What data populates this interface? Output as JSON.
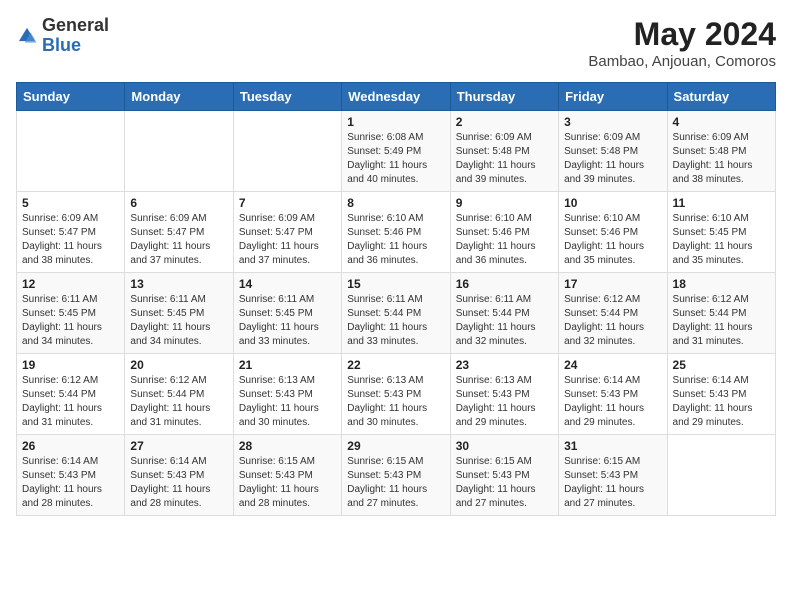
{
  "header": {
    "logo_general": "General",
    "logo_blue": "Blue",
    "title": "May 2024",
    "location": "Bambao, Anjouan, Comoros"
  },
  "days_of_week": [
    "Sunday",
    "Monday",
    "Tuesday",
    "Wednesday",
    "Thursday",
    "Friday",
    "Saturday"
  ],
  "weeks": [
    [
      {
        "day": "",
        "info": ""
      },
      {
        "day": "",
        "info": ""
      },
      {
        "day": "",
        "info": ""
      },
      {
        "day": "1",
        "info": "Sunrise: 6:08 AM\nSunset: 5:49 PM\nDaylight: 11 hours and 40 minutes."
      },
      {
        "day": "2",
        "info": "Sunrise: 6:09 AM\nSunset: 5:48 PM\nDaylight: 11 hours and 39 minutes."
      },
      {
        "day": "3",
        "info": "Sunrise: 6:09 AM\nSunset: 5:48 PM\nDaylight: 11 hours and 39 minutes."
      },
      {
        "day": "4",
        "info": "Sunrise: 6:09 AM\nSunset: 5:48 PM\nDaylight: 11 hours and 38 minutes."
      }
    ],
    [
      {
        "day": "5",
        "info": "Sunrise: 6:09 AM\nSunset: 5:47 PM\nDaylight: 11 hours and 38 minutes."
      },
      {
        "day": "6",
        "info": "Sunrise: 6:09 AM\nSunset: 5:47 PM\nDaylight: 11 hours and 37 minutes."
      },
      {
        "day": "7",
        "info": "Sunrise: 6:09 AM\nSunset: 5:47 PM\nDaylight: 11 hours and 37 minutes."
      },
      {
        "day": "8",
        "info": "Sunrise: 6:10 AM\nSunset: 5:46 PM\nDaylight: 11 hours and 36 minutes."
      },
      {
        "day": "9",
        "info": "Sunrise: 6:10 AM\nSunset: 5:46 PM\nDaylight: 11 hours and 36 minutes."
      },
      {
        "day": "10",
        "info": "Sunrise: 6:10 AM\nSunset: 5:46 PM\nDaylight: 11 hours and 35 minutes."
      },
      {
        "day": "11",
        "info": "Sunrise: 6:10 AM\nSunset: 5:45 PM\nDaylight: 11 hours and 35 minutes."
      }
    ],
    [
      {
        "day": "12",
        "info": "Sunrise: 6:11 AM\nSunset: 5:45 PM\nDaylight: 11 hours and 34 minutes."
      },
      {
        "day": "13",
        "info": "Sunrise: 6:11 AM\nSunset: 5:45 PM\nDaylight: 11 hours and 34 minutes."
      },
      {
        "day": "14",
        "info": "Sunrise: 6:11 AM\nSunset: 5:45 PM\nDaylight: 11 hours and 33 minutes."
      },
      {
        "day": "15",
        "info": "Sunrise: 6:11 AM\nSunset: 5:44 PM\nDaylight: 11 hours and 33 minutes."
      },
      {
        "day": "16",
        "info": "Sunrise: 6:11 AM\nSunset: 5:44 PM\nDaylight: 11 hours and 32 minutes."
      },
      {
        "day": "17",
        "info": "Sunrise: 6:12 AM\nSunset: 5:44 PM\nDaylight: 11 hours and 32 minutes."
      },
      {
        "day": "18",
        "info": "Sunrise: 6:12 AM\nSunset: 5:44 PM\nDaylight: 11 hours and 31 minutes."
      }
    ],
    [
      {
        "day": "19",
        "info": "Sunrise: 6:12 AM\nSunset: 5:44 PM\nDaylight: 11 hours and 31 minutes."
      },
      {
        "day": "20",
        "info": "Sunrise: 6:12 AM\nSunset: 5:44 PM\nDaylight: 11 hours and 31 minutes."
      },
      {
        "day": "21",
        "info": "Sunrise: 6:13 AM\nSunset: 5:43 PM\nDaylight: 11 hours and 30 minutes."
      },
      {
        "day": "22",
        "info": "Sunrise: 6:13 AM\nSunset: 5:43 PM\nDaylight: 11 hours and 30 minutes."
      },
      {
        "day": "23",
        "info": "Sunrise: 6:13 AM\nSunset: 5:43 PM\nDaylight: 11 hours and 29 minutes."
      },
      {
        "day": "24",
        "info": "Sunrise: 6:14 AM\nSunset: 5:43 PM\nDaylight: 11 hours and 29 minutes."
      },
      {
        "day": "25",
        "info": "Sunrise: 6:14 AM\nSunset: 5:43 PM\nDaylight: 11 hours and 29 minutes."
      }
    ],
    [
      {
        "day": "26",
        "info": "Sunrise: 6:14 AM\nSunset: 5:43 PM\nDaylight: 11 hours and 28 minutes."
      },
      {
        "day": "27",
        "info": "Sunrise: 6:14 AM\nSunset: 5:43 PM\nDaylight: 11 hours and 28 minutes."
      },
      {
        "day": "28",
        "info": "Sunrise: 6:15 AM\nSunset: 5:43 PM\nDaylight: 11 hours and 28 minutes."
      },
      {
        "day": "29",
        "info": "Sunrise: 6:15 AM\nSunset: 5:43 PM\nDaylight: 11 hours and 27 minutes."
      },
      {
        "day": "30",
        "info": "Sunrise: 6:15 AM\nSunset: 5:43 PM\nDaylight: 11 hours and 27 minutes."
      },
      {
        "day": "31",
        "info": "Sunrise: 6:15 AM\nSunset: 5:43 PM\nDaylight: 11 hours and 27 minutes."
      },
      {
        "day": "",
        "info": ""
      }
    ]
  ]
}
